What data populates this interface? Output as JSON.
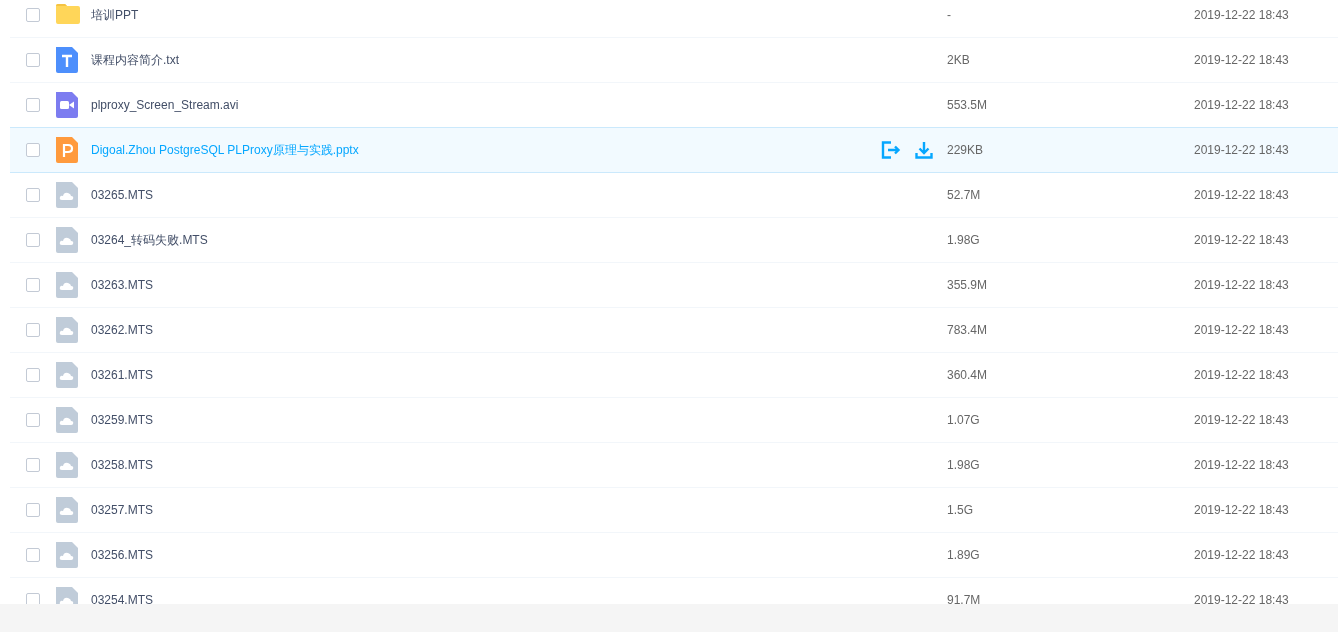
{
  "files": [
    {
      "kind": "folder",
      "name": "培训PPT",
      "size": "-",
      "modified": "2019-12-22 18:43",
      "checked": false,
      "hovered": false
    },
    {
      "kind": "text",
      "name": "课程内容简介.txt",
      "size": "2KB",
      "modified": "2019-12-22 18:43",
      "checked": false,
      "hovered": false
    },
    {
      "kind": "video",
      "name": "plproxy_Screen_Stream.avi",
      "size": "553.5M",
      "modified": "2019-12-22 18:43",
      "checked": false,
      "hovered": false
    },
    {
      "kind": "slides",
      "name": "Digoal.Zhou PostgreSQL PLProxy原理与实践.pptx",
      "size": "229KB",
      "modified": "2019-12-22 18:43",
      "checked": false,
      "hovered": true
    },
    {
      "kind": "other",
      "name": "03265.MTS",
      "size": "52.7M",
      "modified": "2019-12-22 18:43",
      "checked": false,
      "hovered": false
    },
    {
      "kind": "other",
      "name": "03264_转码失败.MTS",
      "size": "1.98G",
      "modified": "2019-12-22 18:43",
      "checked": false,
      "hovered": false
    },
    {
      "kind": "other",
      "name": "03263.MTS",
      "size": "355.9M",
      "modified": "2019-12-22 18:43",
      "checked": false,
      "hovered": false
    },
    {
      "kind": "other",
      "name": "03262.MTS",
      "size": "783.4M",
      "modified": "2019-12-22 18:43",
      "checked": false,
      "hovered": false
    },
    {
      "kind": "other",
      "name": "03261.MTS",
      "size": "360.4M",
      "modified": "2019-12-22 18:43",
      "checked": false,
      "hovered": false
    },
    {
      "kind": "other",
      "name": "03259.MTS",
      "size": "1.07G",
      "modified": "2019-12-22 18:43",
      "checked": false,
      "hovered": false
    },
    {
      "kind": "other",
      "name": "03258.MTS",
      "size": "1.98G",
      "modified": "2019-12-22 18:43",
      "checked": false,
      "hovered": false
    },
    {
      "kind": "other",
      "name": "03257.MTS",
      "size": "1.5G",
      "modified": "2019-12-22 18:43",
      "checked": false,
      "hovered": false
    },
    {
      "kind": "other",
      "name": "03256.MTS",
      "size": "1.89G",
      "modified": "2019-12-22 18:43",
      "checked": false,
      "hovered": false
    },
    {
      "kind": "other",
      "name": "03254.MTS",
      "size": "91.7M",
      "modified": "2019-12-22 18:43",
      "checked": false,
      "hovered": false
    }
  ]
}
